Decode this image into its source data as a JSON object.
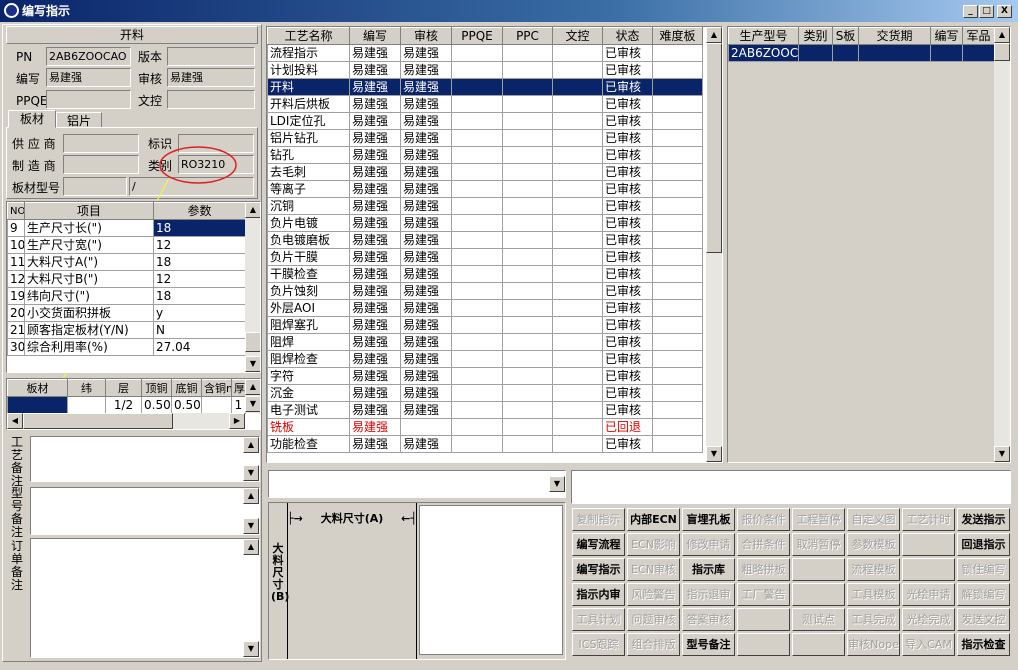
{
  "window": {
    "title": "编写指示",
    "min": "_",
    "max": "□",
    "close": "X"
  },
  "left_panel": {
    "header": "开料",
    "pn_label": "PN",
    "pn_value": "2AB6ZOOCAO",
    "version_label": "版本",
    "version_value": "",
    "writer_label": "编写",
    "writer_value": "易建强",
    "reviewer_label": "审核",
    "reviewer_value": "易建强",
    "ppqe_label": "PPQE",
    "ppqe_value": "",
    "doc_label": "文控",
    "doc_value": "",
    "tabs": [
      "板材",
      "铝片"
    ],
    "supplier_label": "供 应 商",
    "supplier_value": "",
    "mark_label": "标识",
    "mark_value": "",
    "maker_label": "制 造 商",
    "maker_value": "",
    "category_label": "类别",
    "category_value": "RO3210",
    "board_model_label": "板材型号",
    "board_model_value": "",
    "board_model_value2": "/",
    "param_table": {
      "headers": [
        "NO",
        "项目",
        "参数"
      ],
      "rows": [
        {
          "no": "9",
          "item": "生产尺寸长(\")",
          "value": "18"
        },
        {
          "no": "10",
          "item": "生产尺寸宽(\")",
          "value": "12"
        },
        {
          "no": "11",
          "item": "大料尺寸A(\")",
          "value": "18"
        },
        {
          "no": "12",
          "item": "大料尺寸B(\")",
          "value": "12"
        },
        {
          "no": "19",
          "item": "纬向尺寸(\")",
          "value": "18"
        },
        {
          "no": "20",
          "item": "小交货面积拼板",
          "value": "y"
        },
        {
          "no": "21",
          "item": "顾客指定板材(Y/N)",
          "value": "N"
        },
        {
          "no": "30",
          "item": "综合利用率(%)",
          "value": "27.04"
        }
      ]
    },
    "material_table": {
      "headers": [
        "板材",
        "纬",
        "层",
        "顶铜",
        "底铜",
        "含铜mm",
        "厚"
      ],
      "row": [
        "",
        "",
        "1/2",
        "0.50",
        "0.50",
        "",
        "1"
      ]
    },
    "remarks": [
      "工艺备注",
      "型号备注",
      "订单备注"
    ]
  },
  "process_table": {
    "headers": [
      "工艺名称",
      "编写",
      "审核",
      "PPQE",
      "PPC",
      "文控",
      "状态",
      "难度板"
    ],
    "rows": [
      {
        "name": "流程指示",
        "writer": "易建强",
        "reviewer": "易建强",
        "status": "已审核"
      },
      {
        "name": "计划投料",
        "writer": "易建强",
        "reviewer": "易建强",
        "status": "已审核"
      },
      {
        "name": "开料",
        "writer": "易建强",
        "reviewer": "易建强",
        "status": "已审核",
        "selected": true
      },
      {
        "name": "开料后烘板",
        "writer": "易建强",
        "reviewer": "易建强",
        "status": "已审核"
      },
      {
        "name": "LDI定位孔",
        "writer": "易建强",
        "reviewer": "易建强",
        "status": "已审核"
      },
      {
        "name": "铝片钻孔",
        "writer": "易建强",
        "reviewer": "易建强",
        "status": "已审核"
      },
      {
        "name": "钻孔",
        "writer": "易建强",
        "reviewer": "易建强",
        "status": "已审核"
      },
      {
        "name": "去毛刺",
        "writer": "易建强",
        "reviewer": "易建强",
        "status": "已审核"
      },
      {
        "name": "等离子",
        "writer": "易建强",
        "reviewer": "易建强",
        "status": "已审核"
      },
      {
        "name": "沉铜",
        "writer": "易建强",
        "reviewer": "易建强",
        "status": "已审核"
      },
      {
        "name": "负片电镀",
        "writer": "易建强",
        "reviewer": "易建强",
        "status": "已审核"
      },
      {
        "name": "负电镀磨板",
        "writer": "易建强",
        "reviewer": "易建强",
        "status": "已审核"
      },
      {
        "name": "负片干膜",
        "writer": "易建强",
        "reviewer": "易建强",
        "status": "已审核"
      },
      {
        "name": "干膜检查",
        "writer": "易建强",
        "reviewer": "易建强",
        "status": "已审核"
      },
      {
        "name": "负片蚀刻",
        "writer": "易建强",
        "reviewer": "易建强",
        "status": "已审核"
      },
      {
        "name": "外层AOI",
        "writer": "易建强",
        "reviewer": "易建强",
        "status": "已审核"
      },
      {
        "name": "阻焊塞孔",
        "writer": "易建强",
        "reviewer": "易建强",
        "status": "已审核"
      },
      {
        "name": "阻焊",
        "writer": "易建强",
        "reviewer": "易建强",
        "status": "已审核"
      },
      {
        "name": "阻焊检查",
        "writer": "易建强",
        "reviewer": "易建强",
        "status": "已审核"
      },
      {
        "name": "字符",
        "writer": "易建强",
        "reviewer": "易建强",
        "status": "已审核"
      },
      {
        "name": "沉金",
        "writer": "易建强",
        "reviewer": "易建强",
        "status": "已审核"
      },
      {
        "name": "电子测试",
        "writer": "易建强",
        "reviewer": "易建强",
        "status": "已审核"
      },
      {
        "name": "铣板",
        "writer": "易建强",
        "reviewer": "",
        "status": "已回退",
        "red": true
      },
      {
        "name": "功能检查",
        "writer": "易建强",
        "reviewer": "易建强",
        "status": "已审核"
      }
    ]
  },
  "model_table": {
    "headers": [
      "生产型号",
      "类别",
      "S板",
      "交货期",
      "编写",
      "军品"
    ],
    "rows": [
      [
        "2AB6ZOOCAO",
        "",
        "",
        "",
        "",
        ""
      ]
    ]
  },
  "diagram": {
    "dim_a": "大料尺寸(A)",
    "dim_b": "大料尺寸(B)"
  },
  "buttons": [
    [
      "复制指示",
      "内部ECN",
      "盲埋孔板",
      "报价条件",
      "工程暂停",
      "自定义图",
      "工艺计时",
      "发送指示"
    ],
    [
      "编写流程",
      "ECN影响",
      "修改申请",
      "合拼条件",
      "取消暂停",
      "参数模板",
      "",
      "回退指示"
    ],
    [
      "编写指示",
      "ECN审核",
      "指示库",
      "粗略拼板",
      "",
      "流程模板",
      "",
      "锁住编写"
    ],
    [
      "指示内审",
      "风险警告",
      "指示退审",
      "工厂警告",
      "",
      "工具模板",
      "光绘申请",
      "解锁编写"
    ],
    [
      "工具计划",
      "问题审核",
      "答案审核",
      "",
      "测试点",
      "工具完成",
      "光绘完成",
      "发送文控"
    ],
    [
      "ICS跟踪",
      "组合排版",
      "型号备注",
      "",
      "",
      "审核Nope",
      "导入CAM",
      "指示检查"
    ]
  ],
  "button_enabled": [
    [
      false,
      true,
      true,
      false,
      false,
      false,
      false,
      true
    ],
    [
      true,
      false,
      false,
      false,
      false,
      false,
      false,
      true
    ],
    [
      true,
      false,
      true,
      false,
      false,
      false,
      false,
      false
    ],
    [
      true,
      false,
      false,
      false,
      false,
      false,
      false,
      false
    ],
    [
      false,
      false,
      false,
      false,
      false,
      false,
      false,
      false
    ],
    [
      false,
      false,
      true,
      false,
      false,
      false,
      false,
      true
    ]
  ]
}
